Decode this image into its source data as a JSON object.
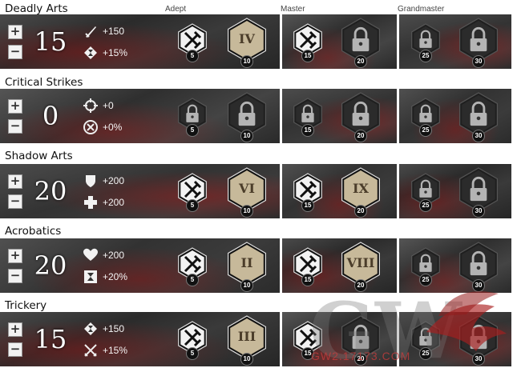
{
  "tiers": {
    "adept": "Adept",
    "master": "Master",
    "grandmaster": "Grandmaster"
  },
  "buttons": {
    "plus": "+",
    "minus": "−"
  },
  "lines": [
    {
      "name": "Deadly Arts",
      "points": "15",
      "stats": [
        {
          "icon": "sword-icon",
          "value": "+150"
        },
        {
          "icon": "condition-duration-icon",
          "value": "+15%"
        }
      ],
      "traits": [
        {
          "type": "minor",
          "state": "unlocked",
          "badge": "5"
        },
        {
          "type": "major",
          "state": "unlocked",
          "badge": "10",
          "roman": "IV"
        },
        {
          "type": "minor",
          "state": "unlocked",
          "badge": "15"
        },
        {
          "type": "major",
          "state": "locked",
          "badge": "20"
        },
        {
          "type": "minor",
          "state": "locked",
          "badge": "25"
        },
        {
          "type": "major",
          "state": "locked",
          "badge": "30"
        }
      ]
    },
    {
      "name": "Critical Strikes",
      "points": "0",
      "stats": [
        {
          "icon": "crosshair-icon",
          "value": "+0"
        },
        {
          "icon": "crit-damage-icon",
          "value": "+0%"
        }
      ],
      "traits": [
        {
          "type": "minor",
          "state": "locked",
          "badge": "5"
        },
        {
          "type": "major",
          "state": "locked",
          "badge": "10"
        },
        {
          "type": "minor",
          "state": "locked",
          "badge": "15"
        },
        {
          "type": "major",
          "state": "locked",
          "badge": "20"
        },
        {
          "type": "minor",
          "state": "locked",
          "badge": "25"
        },
        {
          "type": "major",
          "state": "locked",
          "badge": "30"
        }
      ]
    },
    {
      "name": "Shadow Arts",
      "points": "20",
      "stats": [
        {
          "icon": "shield-icon",
          "value": "+200"
        },
        {
          "icon": "healing-cross-icon",
          "value": "+200"
        }
      ],
      "traits": [
        {
          "type": "minor",
          "state": "unlocked",
          "badge": "5"
        },
        {
          "type": "major",
          "state": "unlocked",
          "badge": "10",
          "roman": "VI"
        },
        {
          "type": "minor",
          "state": "unlocked",
          "badge": "15"
        },
        {
          "type": "major",
          "state": "unlocked",
          "badge": "20",
          "roman": "IX"
        },
        {
          "type": "minor",
          "state": "locked",
          "badge": "25"
        },
        {
          "type": "major",
          "state": "locked",
          "badge": "30"
        }
      ]
    },
    {
      "name": "Acrobatics",
      "points": "20",
      "stats": [
        {
          "icon": "heart-icon",
          "value": "+200"
        },
        {
          "icon": "hourglass-icon",
          "value": "+20%"
        }
      ],
      "traits": [
        {
          "type": "minor",
          "state": "unlocked",
          "badge": "5"
        },
        {
          "type": "major",
          "state": "unlocked",
          "badge": "10",
          "roman": "II"
        },
        {
          "type": "minor",
          "state": "unlocked",
          "badge": "15"
        },
        {
          "type": "major",
          "state": "unlocked",
          "badge": "20",
          "roman": "VIII"
        },
        {
          "type": "minor",
          "state": "locked",
          "badge": "25"
        },
        {
          "type": "major",
          "state": "locked",
          "badge": "30"
        }
      ]
    },
    {
      "name": "Trickery",
      "points": "15",
      "stats": [
        {
          "icon": "condition-duration-icon",
          "value": "+150"
        },
        {
          "icon": "crossed-swords-icon",
          "value": "+15%"
        }
      ],
      "traits": [
        {
          "type": "minor",
          "state": "unlocked",
          "badge": "5"
        },
        {
          "type": "major",
          "state": "unlocked",
          "badge": "10",
          "roman": "III"
        },
        {
          "type": "minor",
          "state": "unlocked",
          "badge": "15"
        },
        {
          "type": "major",
          "state": "locked",
          "badge": "20"
        },
        {
          "type": "minor",
          "state": "locked",
          "badge": "25"
        },
        {
          "type": "major",
          "state": "locked",
          "badge": "30"
        }
      ]
    }
  ],
  "watermark": {
    "logo": "GW",
    "text": "GW2.17173.COM"
  },
  "colors": {
    "unlocked_minor": "#f2f2f2",
    "unlocked_major": "#c7b99a",
    "locked": "#2b2b2b",
    "badge": "#111111"
  }
}
